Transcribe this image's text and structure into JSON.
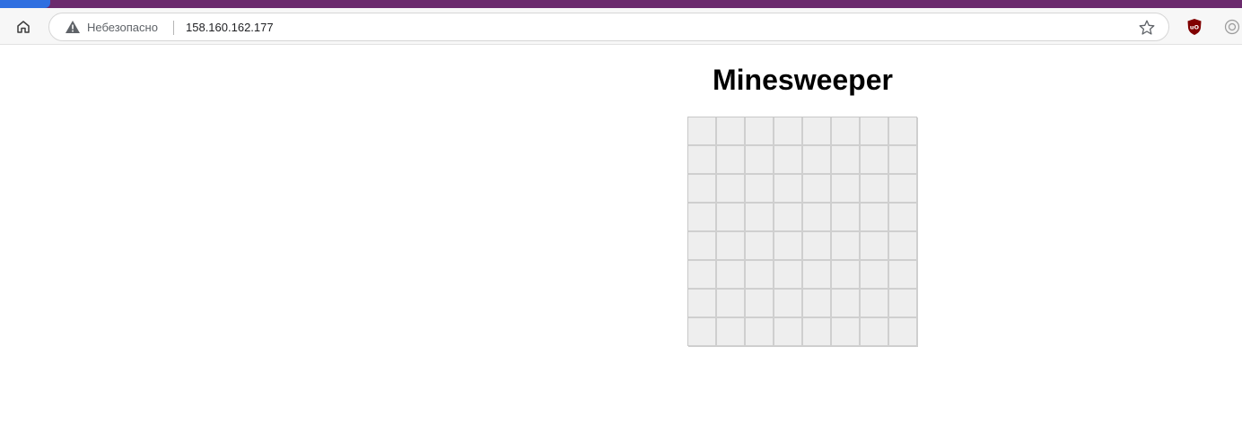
{
  "browser": {
    "security_label": "Небезопасно",
    "url": "158.160.162.177",
    "icons": {
      "home": "home-icon",
      "warning": "warning-icon",
      "bookmark": "star-icon",
      "extension_1": "ublock-icon",
      "extension_2": "extension-icon"
    },
    "colors": {
      "tabstrip": "#6b2a6d",
      "active_tab": "#2f6fe0"
    }
  },
  "game": {
    "title": "Minesweeper",
    "rows": 8,
    "cols": 8,
    "cell_state": "unrevealed",
    "cell_color": "#eeeeee"
  }
}
